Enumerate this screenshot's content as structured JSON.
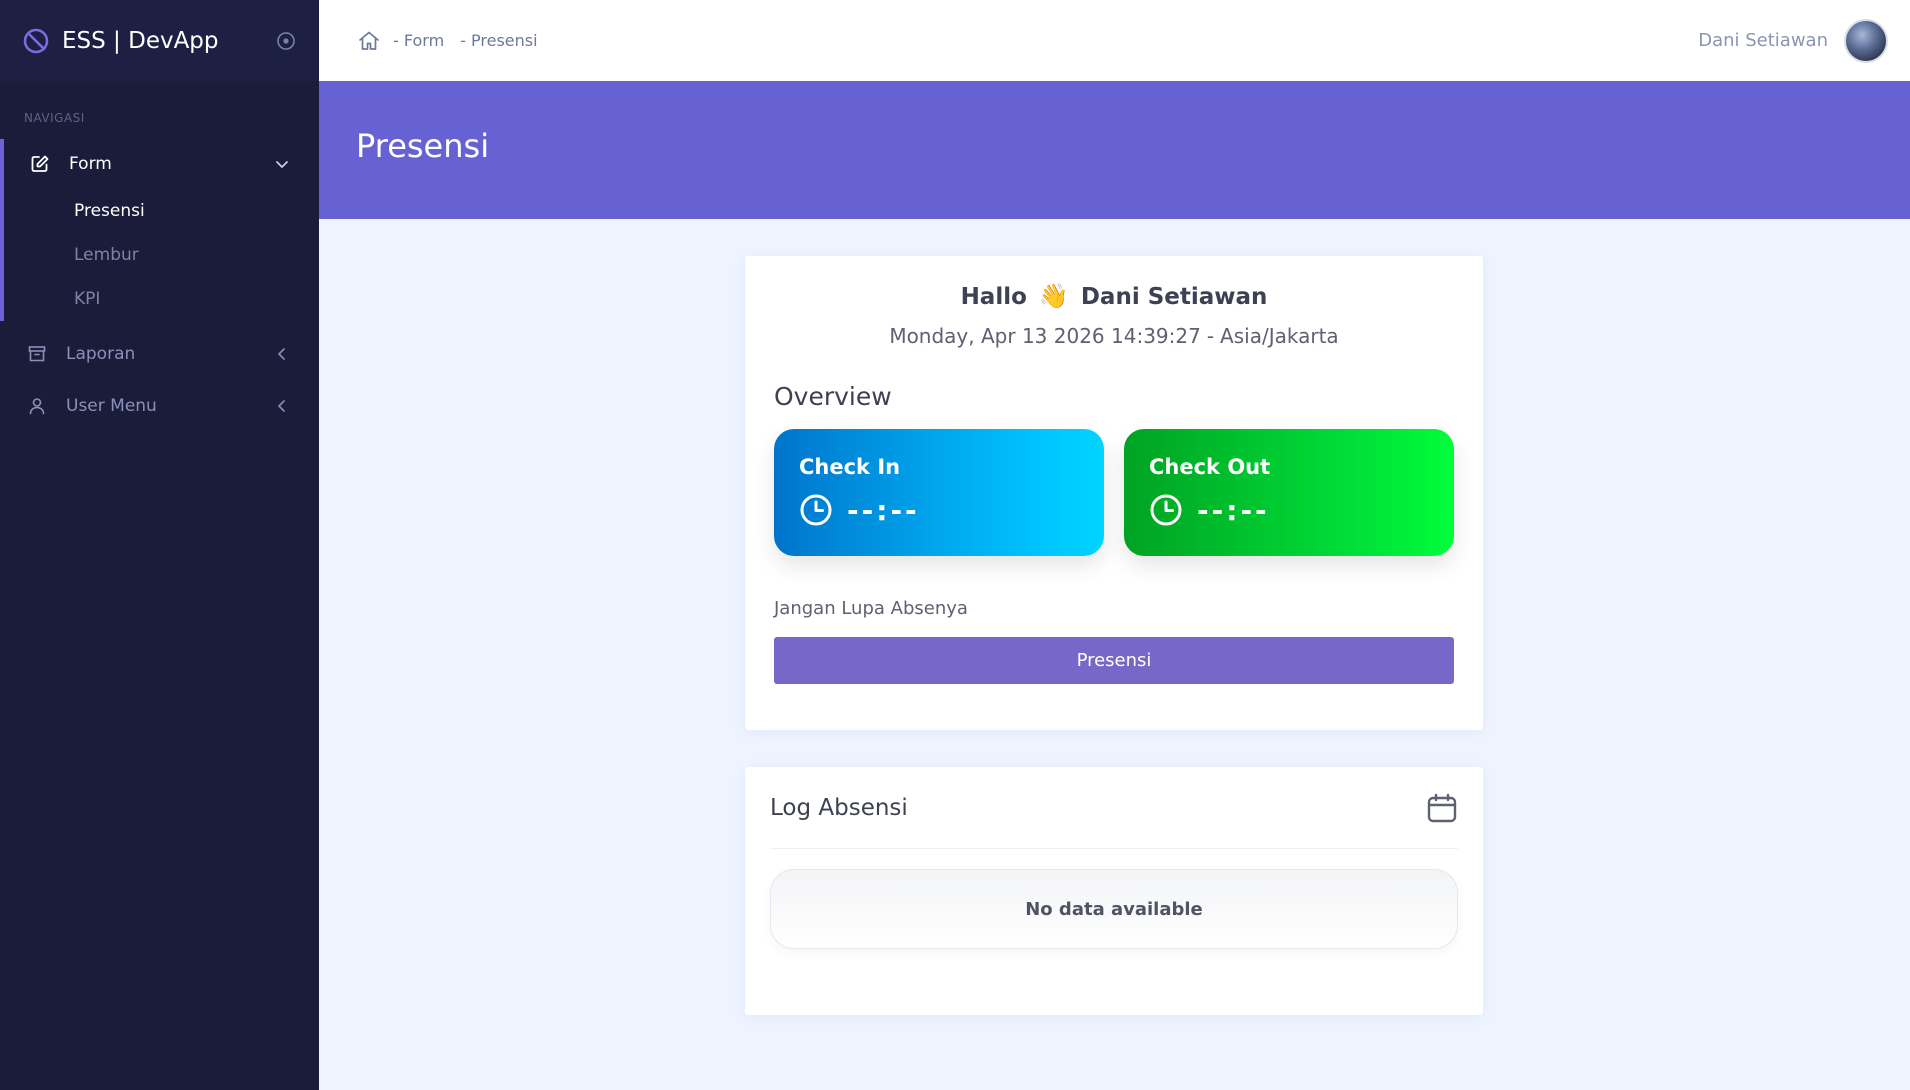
{
  "brand": {
    "title": "ESS | DevApp"
  },
  "sidebar": {
    "heading": "NAVIGASI",
    "groups": [
      {
        "label": "Form",
        "icon": "edit-icon",
        "subitems": [
          {
            "label": "Presensi"
          },
          {
            "label": "Lembur"
          },
          {
            "label": "KPI"
          }
        ]
      },
      {
        "label": "Laporan",
        "icon": "archive-icon"
      },
      {
        "label": "User Menu",
        "icon": "user-icon"
      }
    ]
  },
  "topbar": {
    "breadcrumbs": [
      "- Form",
      "- Presensi"
    ],
    "user_name": "Dani Setiawan"
  },
  "page": {
    "title": "Presensi"
  },
  "greeting": {
    "hello": "Hallo",
    "emoji": "👋",
    "name": "Dani Setiawan",
    "datetime": "Monday, Apr 13 2026 14:39:27",
    "separator": "-",
    "timezone": "Asia/Jakarta"
  },
  "overview": {
    "title": "Overview",
    "check_in": {
      "label": "Check In",
      "time": "--:--",
      "color": "#00c4ff"
    },
    "check_out": {
      "label": "Check Out",
      "time": "--:--",
      "color": "#00e43a"
    },
    "reminder": "Jangan Lupa Absenya",
    "button_label": "Presensi"
  },
  "log": {
    "title": "Log Absensi",
    "empty_text": "No data available"
  },
  "colors": {
    "sidebar_bg": "#1a1c3a",
    "accent": "#6762d4",
    "button": "#7667c9"
  }
}
